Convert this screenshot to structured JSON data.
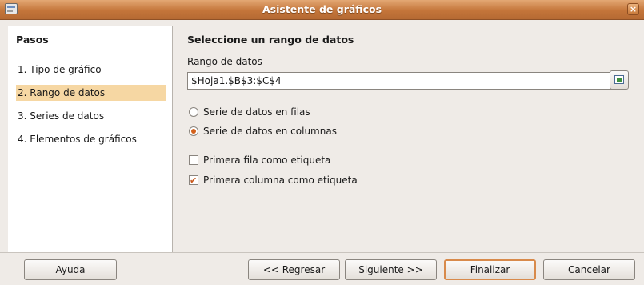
{
  "window": {
    "title": "Asistente de gráficos",
    "close_label": "×"
  },
  "steps": {
    "title": "Pasos",
    "items": [
      {
        "label": "1. Tipo de gráfico",
        "active": false
      },
      {
        "label": "2. Rango de datos",
        "active": true
      },
      {
        "label": "3. Series de datos",
        "active": false
      },
      {
        "label": "4. Elementos de gráficos",
        "active": false
      }
    ]
  },
  "main": {
    "heading": "Seleccione un rango de datos",
    "range_label": "Rango de datos",
    "range_value": "$Hoja1.$B$3:$C$4",
    "options": {
      "series_rows": {
        "label": "Serie de datos en filas",
        "selected": false
      },
      "series_columns": {
        "label": "Serie de datos en columnas",
        "selected": true
      },
      "first_row_label": {
        "label": "Primera fila como etiqueta",
        "checked": false
      },
      "first_column_label": {
        "label": "Primera columna como etiqueta",
        "checked": true
      }
    }
  },
  "buttons": {
    "help": "Ayuda",
    "back": "<< Regresar",
    "next": "Siguiente >>",
    "finish": "Finalizar",
    "cancel": "Cancelar"
  },
  "icons": {
    "app": "chart-wizard-icon",
    "close": "close-icon",
    "shrink": "shrink-range-icon"
  },
  "colors": {
    "titlebar": "#c4753a",
    "active_step": "#f6d7a3",
    "accent": "#d3611c"
  }
}
